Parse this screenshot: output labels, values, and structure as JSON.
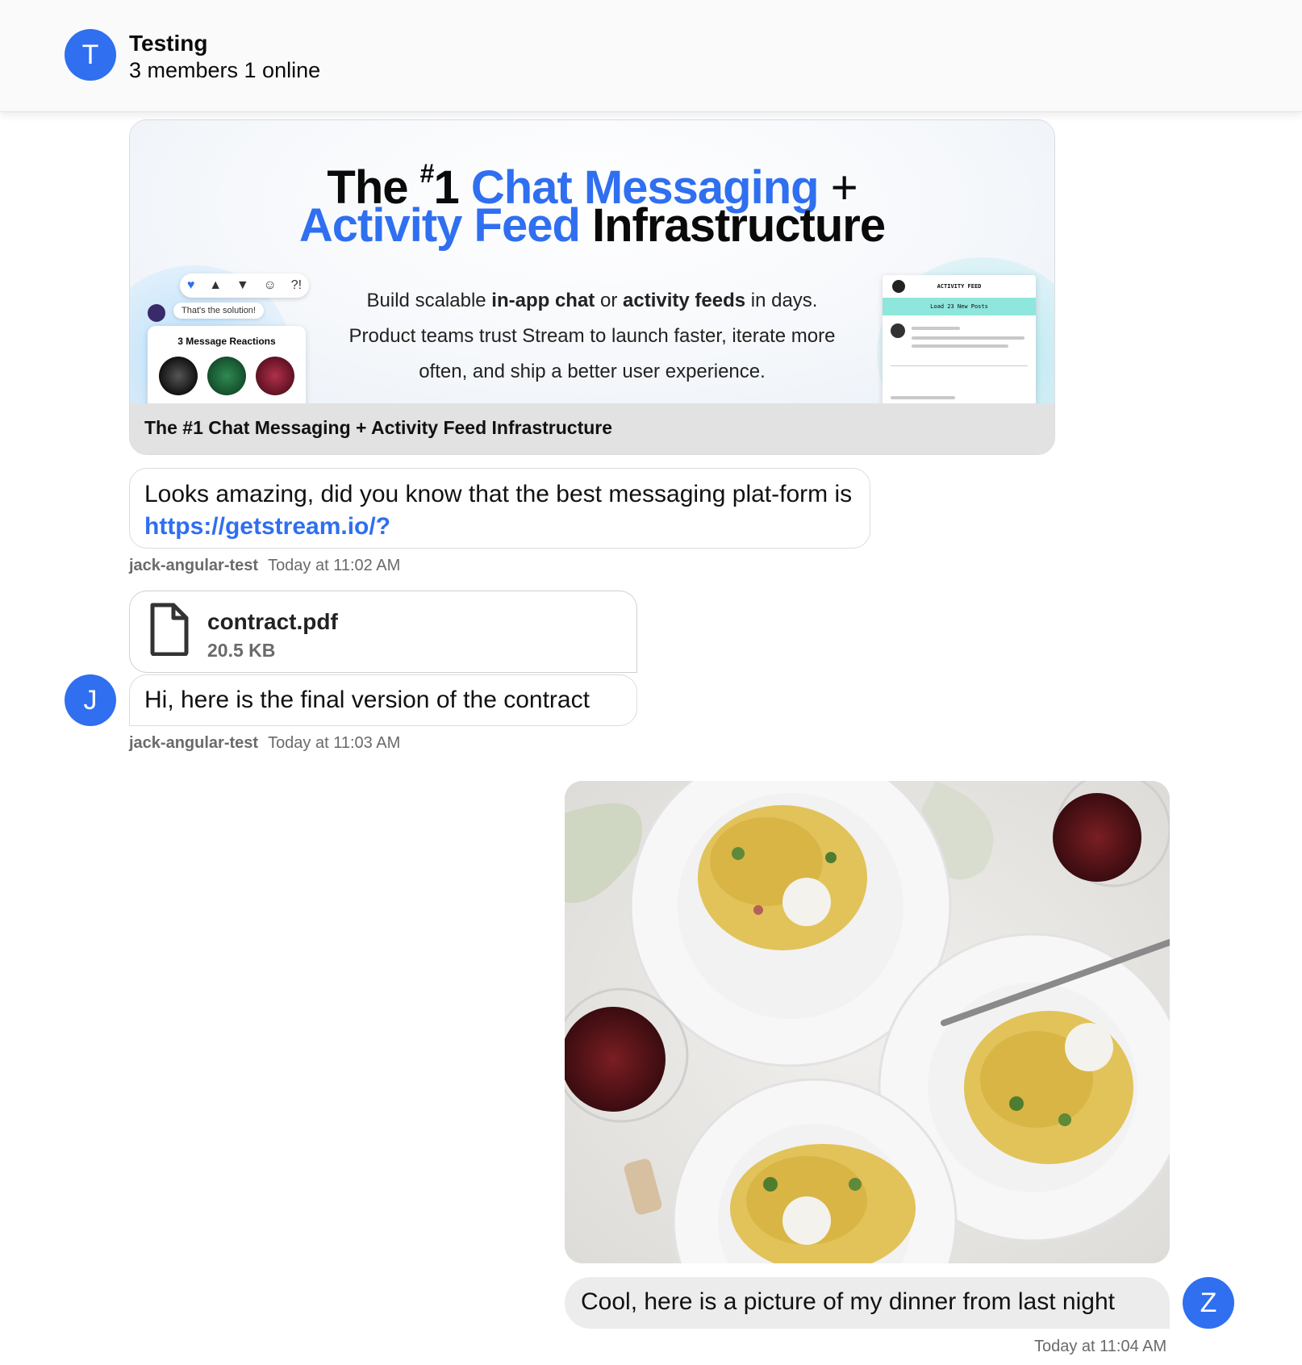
{
  "header": {
    "avatar_initial": "T",
    "title": "Testing",
    "subtitle": "3 members 1 online"
  },
  "link_preview": {
    "hero": {
      "line1_prefix": "The ",
      "line1_sup": "#",
      "line1_num": "1 ",
      "line1_blue": "Chat Messaging",
      "line1_plus": " +",
      "line2_blue": "Activity Feed",
      "line2_rest": " Infrastructure",
      "desc_1": "Build scalable ",
      "desc_b1": "in-app chat",
      "desc_2": " or ",
      "desc_b2": "activity feeds",
      "desc_3": " in days. Product teams trust Stream to launch faster, iterate more often, and ship a better user experience.",
      "mock_bubble": "That's the solution!",
      "mock_card_title": "3 Message Reactions",
      "mock_feed_title": "ACTIVITY FEED",
      "mock_feed_bar": "Load 23 New Posts"
    },
    "title": "The #1 Chat Messaging + Activity Feed Infrastructure"
  },
  "messages": [
    {
      "text_before": "Looks amazing, did you know that the best messaging plat-form is ",
      "link": "https://getstream.io/?",
      "author": "jack-angular-test",
      "time": "Today at 11:02 AM"
    },
    {
      "attachment": {
        "name": "contract.pdf",
        "size": "20.5 KB",
        "icon": "file-icon"
      },
      "text": "Hi, here is the final version of the contract",
      "avatar_initial": "J",
      "author": "jack-angular-test",
      "time": "Today at 11:03 AM"
    },
    {
      "image": "pasta dinner photo",
      "text": "Cool, here is a picture of my dinner from last night",
      "avatar_initial": "Z",
      "time": "Today at 11:04 AM"
    }
  ],
  "colors": {
    "accent": "#2f6ff0",
    "bubble_own": "#ececec",
    "meta_text": "#6a6a6a"
  }
}
